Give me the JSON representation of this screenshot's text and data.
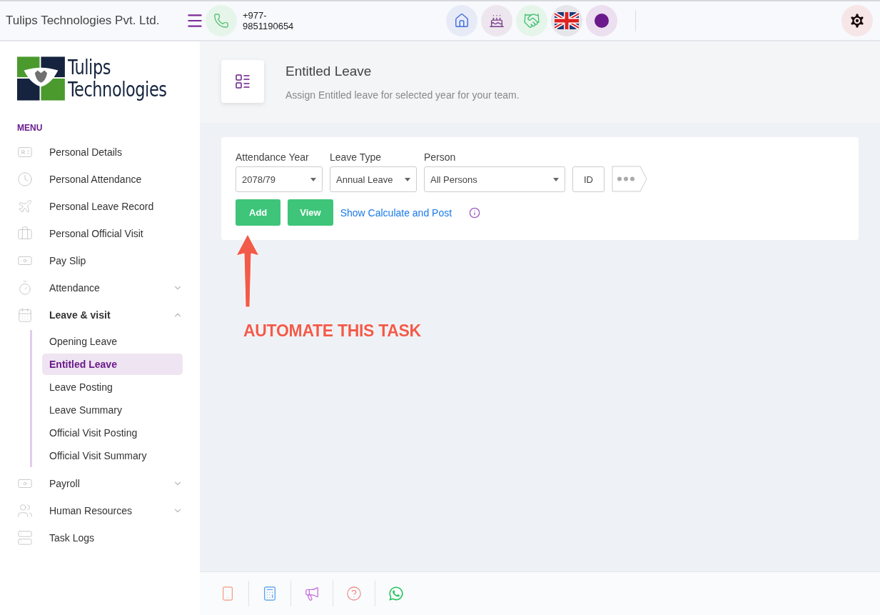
{
  "topbar": {
    "company": "Tulips Technologies Pvt. Ltd.",
    "phone": "+977-\n9851190654"
  },
  "sidebar": {
    "logo": {
      "line1": "Tulips",
      "line2": "Technologies"
    },
    "menu_label": "MENU",
    "items": [
      {
        "label": "Personal Details"
      },
      {
        "label": "Personal Attendance"
      },
      {
        "label": "Personal Leave Record"
      },
      {
        "label": "Personal Official Visit"
      },
      {
        "label": "Pay Slip"
      },
      {
        "label": "Attendance",
        "expanded": false
      },
      {
        "label": "Leave & visit",
        "expanded": true,
        "children": [
          {
            "label": "Opening Leave",
            "selected": false
          },
          {
            "label": "Entitled Leave",
            "selected": true
          },
          {
            "label": "Leave Posting",
            "selected": false
          },
          {
            "label": "Leave Summary",
            "selected": false
          },
          {
            "label": "Official Visit Posting",
            "selected": false
          },
          {
            "label": "Official Visit Summary",
            "selected": false
          }
        ]
      },
      {
        "label": "Payroll",
        "expanded": false
      },
      {
        "label": "Human Resources",
        "expanded": false
      },
      {
        "label": "Task Logs"
      }
    ]
  },
  "page_header": {
    "title": "Entitled Leave",
    "subtitle": "Assign Entitled leave for selected year for your team."
  },
  "form": {
    "fields": [
      {
        "label": "Attendance Year",
        "value": "2078/79"
      },
      {
        "label": "Leave Type",
        "value": "Annual Leave"
      },
      {
        "label": "Person",
        "value": "All Persons"
      }
    ],
    "id_button": "ID",
    "buttons": [
      "Add",
      "View"
    ],
    "link": "Show Calculate and Post"
  },
  "annotation": {
    "text": "AUTOMATE THIS TASK"
  }
}
